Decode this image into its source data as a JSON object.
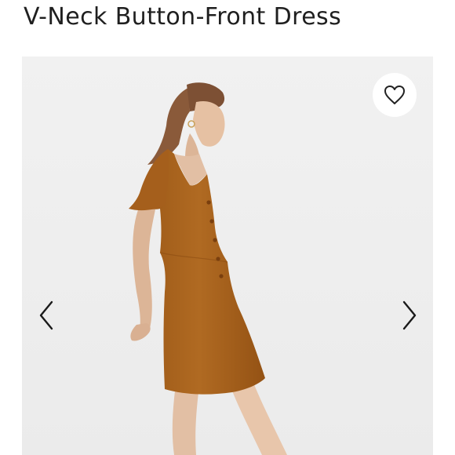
{
  "product": {
    "title": "V-Neck Button-Front Dress"
  },
  "gallery": {
    "background": "#efefef",
    "dress_color": "#a8621d",
    "icons": {
      "favorite": "heart-icon",
      "previous": "chevron-left-icon",
      "next": "chevron-right-icon"
    }
  }
}
